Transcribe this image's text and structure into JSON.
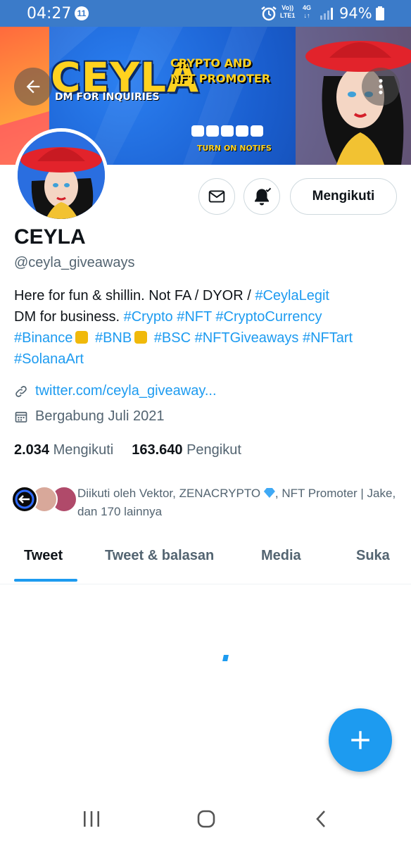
{
  "status_bar": {
    "time": "04:27",
    "notification_count": "11",
    "volte_line1": "Vo))",
    "volte_line2": "LTE1",
    "network_line1": "4G",
    "network_line2": "↓↑",
    "battery": "94%"
  },
  "banner": {
    "title": "CEYLA",
    "subtitle_line1": "CRYPTO AND",
    "subtitle_line2": "NFT PROMOTER",
    "dm_text": "DM FOR INQUIRIES",
    "notif_text": "TURN ON NOTIFS"
  },
  "profile": {
    "name": "CEYLA",
    "handle": "@ceyla_giveaways",
    "bio": {
      "line1_text": "Here for fun & shillin. Not FA / DYOR  / ",
      "line1_tag": "#CeylaLegit",
      "line2_text": "DM for business.  ",
      "line2_tags": "#Crypto #NFT #CryptoCurrency",
      "tag_binance": "#Binance",
      "tag_bnb": "#BNB",
      "line3_tags": "#BSC #NFTGiveaways #NFTart",
      "line4_tag": "#SolanaArt"
    },
    "website": "twitter.com/ceyla_giveaway...",
    "joined": "Bergabung Juli 2021",
    "following_count": "2.034",
    "following_label": "Mengikuti",
    "followers_count": "163.640",
    "followers_label": "Pengikut",
    "followed_by_part1": "Diikuti oleh Vektor, ZENACRYPTO ",
    "followed_by_part2": ", NFT Promoter | Jake, dan 170 lainnya"
  },
  "actions": {
    "follow_button": "Mengikuti"
  },
  "tabs": [
    "Tweet",
    "Tweet & balasan",
    "Media",
    "Suka"
  ],
  "colors": {
    "accent": "#1d9bf0",
    "status_bar": "#3b7bc9",
    "secondary_text": "#536471"
  },
  "icons": {
    "back": "arrow-left-icon",
    "more": "more-vertical-icon",
    "message": "envelope-icon",
    "notifications": "bell-check-icon",
    "link": "link-icon",
    "calendar": "calendar-icon",
    "compose": "plus-icon"
  }
}
